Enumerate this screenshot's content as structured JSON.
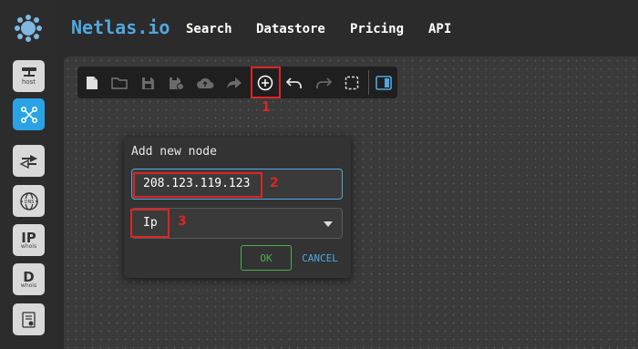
{
  "header": {
    "brand": "Netlas.io",
    "nav": [
      "Search",
      "Datastore",
      "Pricing",
      "API"
    ]
  },
  "sidebar": {
    "items": [
      {
        "label": "host",
        "icon": "host-icon"
      },
      {
        "icon": "graph-icon",
        "active": true
      },
      {
        "icon": "redirect-icon"
      },
      {
        "icon": "dns-icon",
        "badge": "DNS"
      },
      {
        "label": "IP",
        "sub": "whois",
        "icon": "ip-whois-icon"
      },
      {
        "label": "D",
        "sub": "whois",
        "icon": "domain-whois-icon"
      },
      {
        "icon": "certificate-icon"
      }
    ]
  },
  "toolbar": {
    "icons": [
      "new-file-icon",
      "open-folder-icon",
      "save-icon",
      "save-as-icon",
      "cloud-upload-icon",
      "share-icon",
      "add-node-icon",
      "undo-icon",
      "redo-icon",
      "select-area-icon",
      "panel-toggle-icon"
    ]
  },
  "annotations": {
    "one": "1",
    "two": "2",
    "three": "3"
  },
  "dialog": {
    "title": "Add new node",
    "ip_value": "208.123.119.123",
    "type_value": "Ip",
    "ok_label": "OK",
    "cancel_label": "CANCEL"
  },
  "colors": {
    "accent": "#4fa8e0",
    "active_rail": "#29a3e6",
    "highlight": "#e02424",
    "ok": "#4caf50"
  }
}
